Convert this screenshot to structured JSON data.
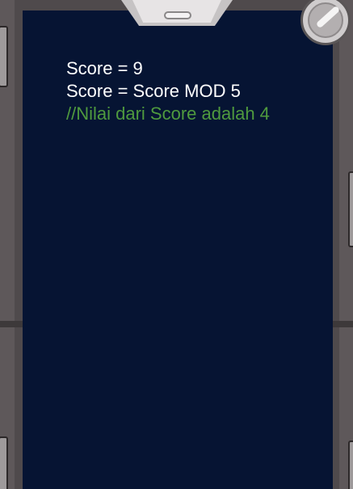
{
  "code": {
    "lines": [
      {
        "text": "Score = 9",
        "kind": "statement"
      },
      {
        "text": "Score = Score MOD 5",
        "kind": "statement"
      },
      {
        "text": "//Nilai dari Score adalah 4",
        "kind": "comment"
      }
    ]
  },
  "colors": {
    "screen_background": "#061433",
    "statement_text": "#ffffff",
    "comment_text": "#4f9a3e",
    "device_body": "#5e585a"
  },
  "icons": {
    "camera": "camera-lens-icon",
    "speaker": "earpiece-speaker-icon"
  }
}
